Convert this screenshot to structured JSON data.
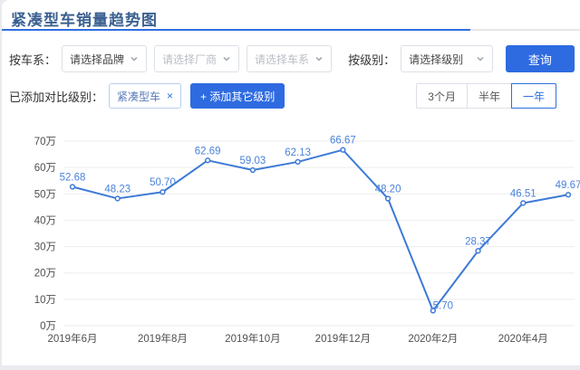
{
  "page": {
    "title": "紧凑型车销量趋势图"
  },
  "filters": {
    "series_label": "按车系：",
    "brand_select": "请选择品牌",
    "manufacturer_select": "请选择厂商",
    "car_series_select": "请选择车系",
    "level_label": "按级别：",
    "level_select": "请选择级别",
    "query_button": "查询"
  },
  "comparison": {
    "label": "已添加对比级别：",
    "tag": "紧凑型车",
    "tag_close": "×",
    "add_button": "+ 添加其它级别"
  },
  "time_range": {
    "options": [
      "3个月",
      "半年",
      "一年"
    ],
    "selected": "一年"
  },
  "colors": {
    "accent": "#2e6be1",
    "line": "#3d7ad6",
    "data_label": "#4a82da",
    "title": "#3b6191",
    "grid": "#ededed",
    "axis_text": "#4f4f4f"
  },
  "chart_data": {
    "type": "line",
    "values": [
      52.68,
      48.23,
      50.7,
      62.69,
      59.03,
      62.13,
      66.67,
      48.2,
      5.7,
      28.37,
      46.51,
      49.67
    ],
    "x_tick_labels": [
      "2019年6月",
      "2019年8月",
      "2019年10月",
      "2019年12月",
      "2020年2月",
      "2020年4月"
    ],
    "x_tick_point_indices": [
      0,
      2,
      4,
      6,
      8,
      10
    ],
    "y_tick_labels": [
      "0万",
      "10万",
      "20万",
      "30万",
      "40万",
      "50万",
      "60万",
      "70万"
    ],
    "y_ticks": [
      0,
      10,
      20,
      30,
      40,
      50,
      60,
      70
    ],
    "ylim": [
      0,
      70
    ],
    "unit": "万",
    "grid": true,
    "legend": false
  }
}
